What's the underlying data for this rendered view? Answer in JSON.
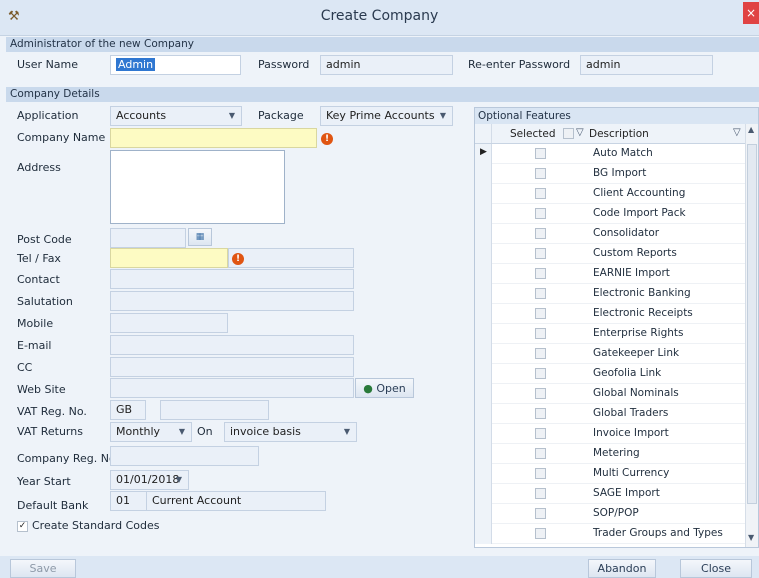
{
  "window": {
    "title": "Create Company",
    "close_glyph": "×"
  },
  "admin": {
    "section": "Administrator of the new Company",
    "username_label": "User Name",
    "username_value": "Admin",
    "password_label": "Password",
    "password_value": "admin",
    "reenter_label": "Re-enter Password",
    "reenter_value": "admin"
  },
  "company": {
    "section": "Company Details",
    "application_label": "Application",
    "application_value": "Accounts",
    "package_label": "Package",
    "package_value": "Key Prime Accounts",
    "name_label": "Company Name",
    "name_value": "",
    "address_label": "Address",
    "address_value": "",
    "postcode_label": "Post Code",
    "postcode_value": "",
    "tel_label": "Tel / Fax",
    "tel_value": "",
    "fax_value": "",
    "contact_label": "Contact",
    "contact_value": "",
    "salutation_label": "Salutation",
    "salutation_value": "",
    "mobile_label": "Mobile",
    "mobile_value": "",
    "email_label": "E-mail",
    "email_value": "",
    "cc_label": "CC",
    "cc_value": "",
    "website_label": "Web Site",
    "website_value": "",
    "open_button": "Open",
    "vat_label": "VAT Reg. No.",
    "vat_prefix": "GB",
    "vat_value": "",
    "vat_returns_label": "VAT Returns",
    "vat_returns_value": "Monthly",
    "on_label": "On",
    "on_value": "invoice basis",
    "reg_label": "Company Reg. No.",
    "reg_value": "",
    "year_label": "Year Start",
    "year_value": "01/01/2018",
    "bank_label": "Default Bank",
    "bank_code": "01",
    "bank_name": "Current Account",
    "create_codes_label": "Create Standard Codes"
  },
  "features": {
    "header": "Optional Features",
    "col_selected": "Selected",
    "col_description": "Description",
    "items": [
      "Auto Match",
      "BG Import",
      "Client Accounting",
      "Code Import Pack",
      "Consolidator",
      "Custom Reports",
      "EARNIE Import",
      "Electronic Banking",
      "Electronic Receipts",
      "Enterprise Rights",
      "Gatekeeper Link",
      "Geofolia Link",
      "Global Nominals",
      "Global Traders",
      "Invoice Import",
      "Metering",
      "Multi Currency",
      "SAGE Import",
      "SOP/POP",
      "Trader Groups and Types"
    ]
  },
  "buttons": {
    "save": "Save",
    "abandon": "Abandon",
    "close": "Close"
  },
  "icons": {
    "required": "error-icon",
    "postcode_lookup": "map-icon",
    "web": "globe-icon"
  }
}
